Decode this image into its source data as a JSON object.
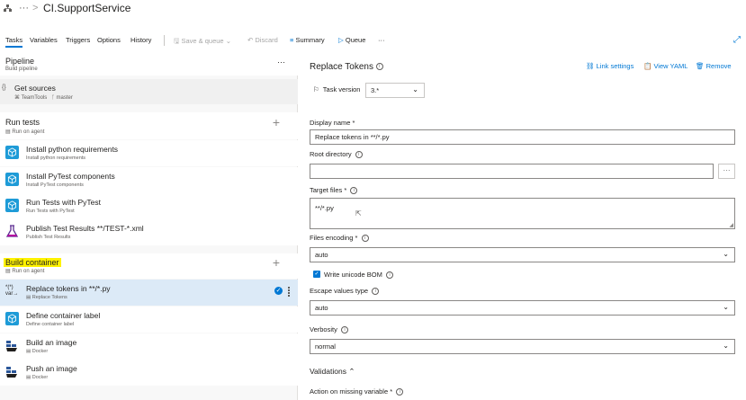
{
  "header": {
    "breadcrumb_more": "···",
    "separator": ">",
    "title": "CI.SupportService"
  },
  "toolbar": {
    "tabs": [
      "Tasks",
      "Variables",
      "Triggers",
      "Options",
      "History"
    ],
    "save_queue": "Save & queue",
    "discard": "Discard",
    "summary": "Summary",
    "queue": "Queue",
    "more": "···"
  },
  "pipeline": {
    "title": "Pipeline",
    "subtitle": "Build pipeline",
    "more": "···"
  },
  "get_sources": {
    "title": "Get sources",
    "repo": "TeamTools",
    "branch": "master"
  },
  "jobs": [
    {
      "title": "Run tests",
      "subtitle": "Run on agent",
      "tasks": [
        {
          "name": "Install python requirements",
          "sub": "Install python requirements",
          "icon": "cube-icon"
        },
        {
          "name": "Install PyTest components",
          "sub": "Install PyTest components",
          "icon": "cube-icon"
        },
        {
          "name": "Run Tests with PyTest",
          "sub": "Run Tests with PyTest",
          "icon": "cube-icon"
        },
        {
          "name": "Publish Test Results **/TEST-*.xml",
          "sub": "Publish Test Results",
          "icon": "flask-icon"
        }
      ]
    },
    {
      "title": "Build container",
      "subtitle": "Run on agent",
      "tasks": [
        {
          "name": "Replace tokens in **/*.py",
          "sub": "Replace Tokens",
          "icon": "variable-icon",
          "selected": true
        },
        {
          "name": "Define container label",
          "sub": "Define container label",
          "icon": "cube-icon"
        },
        {
          "name": "Build an image",
          "sub": "Docker",
          "icon": "docker-icon"
        },
        {
          "name": "Push an image",
          "sub": "Docker",
          "icon": "docker-icon"
        }
      ]
    }
  ],
  "detail": {
    "title": "Replace Tokens",
    "link_settings": "Link settings",
    "view_yaml": "View YAML",
    "remove": "Remove",
    "task_version_label": "Task version",
    "task_version_value": "3.*",
    "display_name_label": "Display name *",
    "display_name_value": "Replace tokens in **/*.py",
    "root_directory_label": "Root directory",
    "root_directory_value": "",
    "browse": "···",
    "target_files_label": "Target files *",
    "target_files_value": "**/*.py",
    "files_encoding_label": "Files encoding *",
    "files_encoding_value": "auto",
    "write_bom_label": "Write unicode BOM",
    "escape_label": "Escape values type",
    "escape_value": "auto",
    "verbosity_label": "Verbosity",
    "verbosity_value": "normal",
    "validations_label": "Validations",
    "action_missing_label": "Action on missing variable *"
  },
  "colors": {
    "accent": "#0078d4",
    "selected_row": "#dceaf7",
    "task_icon": "#1e9bd7",
    "highlight": "#fff200"
  }
}
